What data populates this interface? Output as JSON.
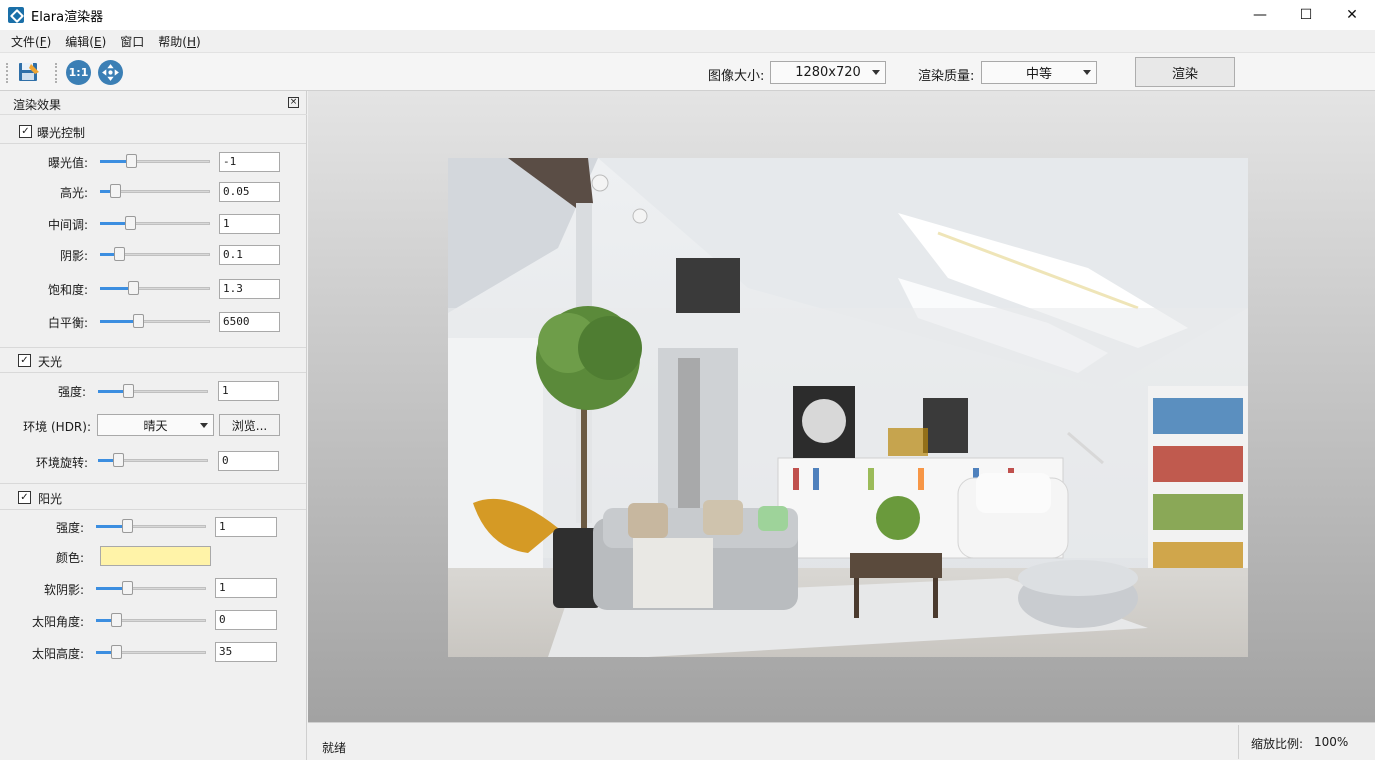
{
  "app": {
    "title": "Elara渲染器"
  },
  "window": {
    "minimize": "—",
    "maximize": "☐",
    "close": "✕"
  },
  "menu": [
    {
      "label": "文件(",
      "key": "F",
      "tail": ")"
    },
    {
      "label": "编辑(",
      "key": "E",
      "tail": ")"
    },
    {
      "label": "窗口",
      "key": "",
      "tail": ""
    },
    {
      "label": "帮助(",
      "key": "H",
      "tail": ")"
    }
  ],
  "toolbar": {
    "icons": [
      "save-render-icon",
      "actual-size-icon",
      "fit-view-icon"
    ],
    "actual_size_label": "1:1",
    "image_size_label": "图像大小:",
    "image_size_value": "1280x720",
    "quality_label": "渲染质量:",
    "quality_value": "中等",
    "render_label": "渲染"
  },
  "panel": {
    "title": "渲染效果",
    "close": "×",
    "exposure": {
      "label": "曝光控制",
      "checked": true,
      "rows": [
        {
          "label": "曝光值:",
          "value": "-1",
          "level": 0.26
        },
        {
          "label": "高光:",
          "value": "0.05",
          "level": 0.1
        },
        {
          "label": "中间调:",
          "value": "1",
          "level": 0.25
        },
        {
          "label": "阴影:",
          "value": "0.1",
          "level": 0.14
        },
        {
          "label": "饱和度:",
          "value": "1.3",
          "level": 0.28
        },
        {
          "label": "白平衡:",
          "value": "6500",
          "level": 0.33
        }
      ]
    },
    "sky": {
      "label": "天光",
      "checked": true,
      "strength_label": "强度:",
      "strength_value": "1",
      "strength_level": 0.25,
      "env_label": "环境 (HDR):",
      "env_value": "晴天",
      "browse_label": "浏览...",
      "rotate_label": "环境旋转:",
      "rotate_value": "0",
      "rotate_level": 0.15
    },
    "sun": {
      "label": "阳光",
      "checked": true,
      "strength_label": "强度:",
      "strength_value": "1",
      "strength_level": 0.26,
      "color_label": "颜色:",
      "color_value": "#fff3a8",
      "soft_label": "软阴影:",
      "soft_value": "1",
      "soft_level": 0.26,
      "angle_label": "太阳角度:",
      "angle_value": "0",
      "angle_level": 0.15,
      "height_label": "太阳高度:",
      "height_value": "35",
      "height_level": 0.15
    }
  },
  "status": {
    "text": "就绪",
    "zoom_label": "缩放比例:",
    "zoom_value": "100%"
  },
  "colors": {
    "accent": "#3c8ee0",
    "title_icon": "#1a6fa8"
  }
}
